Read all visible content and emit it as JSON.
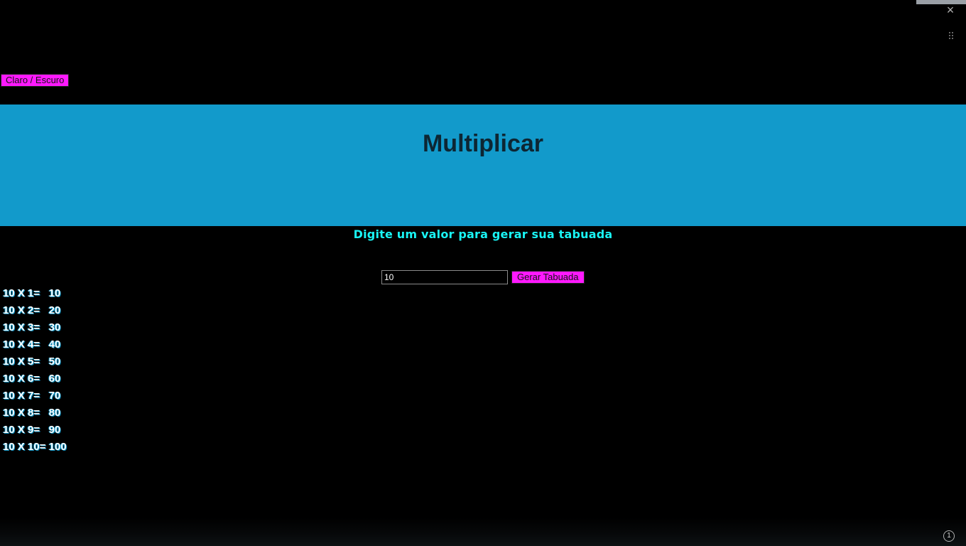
{
  "toolbar": {
    "theme_toggle_label": "Claro / Escuro"
  },
  "banner": {
    "title": "Multiplicar",
    "background_color": "#129acb"
  },
  "form": {
    "prompt": "Digite um valor para gerar sua tabuada",
    "input_value": "10",
    "button_label": "Gerar Tabuada"
  },
  "results": [
    "10 X 1=   10",
    "10 X 2=   20",
    "10 X 3=   30",
    "10 X 4=   40",
    "10 X 5=   50",
    "10 X 6=   60",
    "10 X 7=   70",
    "10 X 8=   80",
    "10 X 9=   90",
    "10 X 10= 100"
  ],
  "window": {
    "close_glyph": "×",
    "badge_count": "1"
  },
  "colors": {
    "accent_button": "#ff19ff",
    "prompt_text": "#19f5f5",
    "page_background": "#000000"
  }
}
